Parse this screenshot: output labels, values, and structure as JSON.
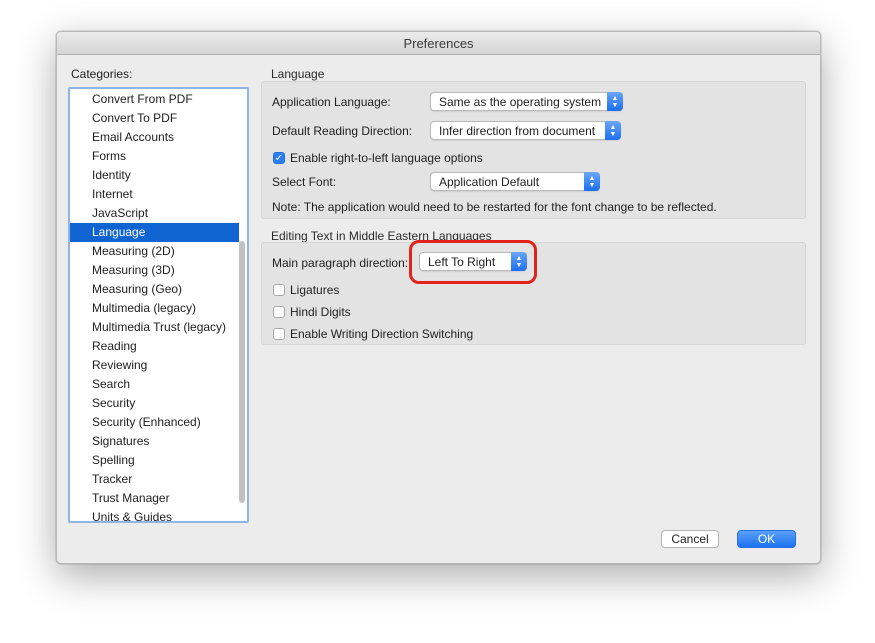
{
  "window": {
    "title": "Preferences"
  },
  "categories": {
    "label": "Categories:",
    "items": [
      "Convert From PDF",
      "Convert To PDF",
      "Email Accounts",
      "Forms",
      "Identity",
      "Internet",
      "JavaScript",
      "Language",
      "Measuring (2D)",
      "Measuring (3D)",
      "Measuring (Geo)",
      "Multimedia (legacy)",
      "Multimedia Trust (legacy)",
      "Reading",
      "Reviewing",
      "Search",
      "Security",
      "Security (Enhanced)",
      "Signatures",
      "Spelling",
      "Tracker",
      "Trust Manager",
      "Units & Guides"
    ],
    "selected": "Language"
  },
  "language": {
    "title": "Language",
    "app_language_label": "Application Language:",
    "app_language_value": "Same as the operating system",
    "reading_direction_label": "Default Reading Direction:",
    "reading_direction_value": "Infer direction from document",
    "rtl_checkbox_label": "Enable right-to-left language options",
    "rtl_checked": true,
    "font_label": "Select Font:",
    "font_value": "Application Default",
    "note": "Note: The application would need to be restarted for the font change to be reflected."
  },
  "middle_eastern": {
    "title": "Editing Text in Middle Eastern Languages",
    "paragraph_direction_label": "Main paragraph direction:",
    "paragraph_direction_value": "Left To Right",
    "ligatures_label": "Ligatures",
    "hindi_digits_label": "Hindi Digits",
    "writing_direction_label": "Enable Writing Direction Switching"
  },
  "buttons": {
    "cancel": "Cancel",
    "ok": "OK"
  },
  "colors": {
    "accent": "#0f64d2",
    "highlight": "#e2231a"
  }
}
